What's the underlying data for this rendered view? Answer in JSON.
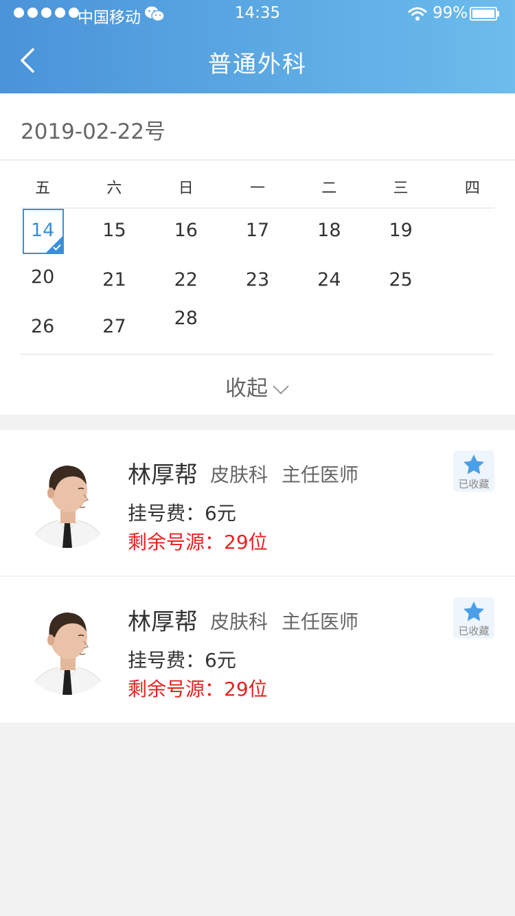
{
  "status_bar": {
    "carrier": "中国移动",
    "time": "14:35",
    "battery": "99%"
  },
  "header": {
    "title": "普通外科"
  },
  "calendar": {
    "date_title": "2019-02-22号",
    "weekdays": [
      "五",
      "六",
      "日",
      "一",
      "二",
      "三",
      "四"
    ],
    "days": [
      "14",
      "15",
      "16",
      "17",
      "18",
      "19",
      "20",
      "21",
      "22",
      "23",
      "24",
      "25",
      "26",
      "27",
      "28"
    ],
    "selected_day": "14",
    "collapse_label": "收起"
  },
  "doctors": [
    {
      "name": "林厚帮",
      "department": "皮肤科",
      "title": "主任医师",
      "fee": "挂号费：6元",
      "remaining": "剩余号源：29位",
      "favorite_label": "已收藏"
    },
    {
      "name": "林厚帮",
      "department": "皮肤科",
      "title": "主任医师",
      "fee": "挂号费：6元",
      "remaining": "剩余号源：29位",
      "favorite_label": "已收藏"
    }
  ],
  "colors": {
    "header_start": "#4a93d9",
    "header_end": "#6cbcec",
    "accent": "#3a8fd8",
    "remaining_text": "#e6211e"
  },
  "icons": {
    "back": "chevron-left-icon",
    "collapse": "chevron-down-icon",
    "favorite": "star-icon",
    "selected": "check-icon"
  }
}
